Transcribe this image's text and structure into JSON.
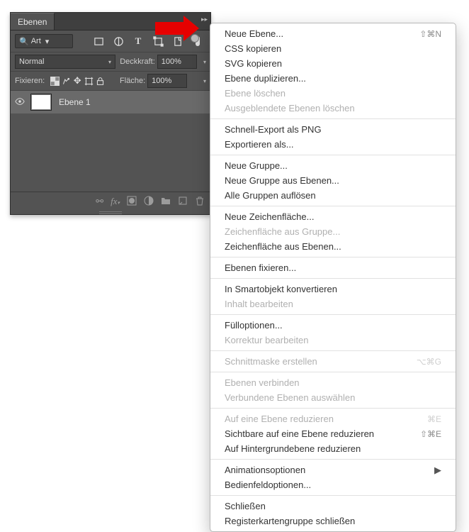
{
  "panel": {
    "tab": "Ebenen",
    "search_label": "Art",
    "blend_mode": "Normal",
    "opacity_label": "Deckkraft:",
    "opacity_value": "100%",
    "lock_label": "Fixieren:",
    "fill_label": "Fläche:",
    "fill_value": "100%",
    "layer_name": "Ebene 1"
  },
  "menu": {
    "items": [
      {
        "label": "Neue Ebene...",
        "shortcut": "⇧⌘N"
      },
      {
        "label": "CSS kopieren"
      },
      {
        "label": "SVG kopieren"
      },
      {
        "label": "Ebene duplizieren..."
      },
      {
        "label": "Ebene löschen",
        "disabled": true
      },
      {
        "label": "Ausgeblendete Ebenen löschen",
        "disabled": true
      },
      {
        "sep": true
      },
      {
        "label": "Schnell-Export als PNG"
      },
      {
        "label": "Exportieren als..."
      },
      {
        "sep": true
      },
      {
        "label": "Neue Gruppe..."
      },
      {
        "label": "Neue Gruppe aus Ebenen..."
      },
      {
        "label": "Alle Gruppen auflösen"
      },
      {
        "sep": true
      },
      {
        "label": "Neue Zeichenfläche..."
      },
      {
        "label": "Zeichenfläche aus Gruppe...",
        "disabled": true
      },
      {
        "label": "Zeichenfläche aus Ebenen..."
      },
      {
        "sep": true
      },
      {
        "label": "Ebenen fixieren..."
      },
      {
        "sep": true
      },
      {
        "label": "In Smartobjekt konvertieren"
      },
      {
        "label": "Inhalt bearbeiten",
        "disabled": true
      },
      {
        "sep": true
      },
      {
        "label": "Fülloptionen..."
      },
      {
        "label": "Korrektur bearbeiten",
        "disabled": true
      },
      {
        "sep": true
      },
      {
        "label": "Schnittmaske erstellen",
        "shortcut": "⌥⌘G",
        "disabled": true
      },
      {
        "sep": true
      },
      {
        "label": "Ebenen verbinden",
        "disabled": true
      },
      {
        "label": "Verbundene Ebenen auswählen",
        "disabled": true
      },
      {
        "sep": true
      },
      {
        "label": "Auf eine Ebene reduzieren",
        "shortcut": "⌘E",
        "disabled": true
      },
      {
        "label": "Sichtbare auf eine Ebene reduzieren",
        "shortcut": "⇧⌘E"
      },
      {
        "label": "Auf Hintergrundebene reduzieren"
      },
      {
        "sep": true
      },
      {
        "label": "Animationsoptionen",
        "submenu": true
      },
      {
        "label": "Bedienfeldoptionen..."
      },
      {
        "sep": true
      },
      {
        "label": "Schließen"
      },
      {
        "label": "Registerkartengruppe schließen"
      }
    ]
  }
}
